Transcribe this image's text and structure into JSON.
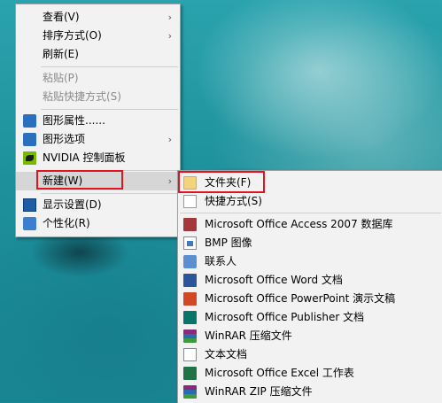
{
  "context_menu": {
    "items": [
      {
        "label": "查看(V)",
        "submenu": true
      },
      {
        "label": "排序方式(O)",
        "submenu": true
      },
      {
        "label": "刷新(E)"
      },
      {
        "label": "粘贴(P)",
        "disabled": true
      },
      {
        "label": "粘贴快捷方式(S)",
        "disabled": true
      },
      {
        "label": "图形属性......",
        "icon": "graphics-icon"
      },
      {
        "label": "图形选项",
        "icon": "graphics-options-icon",
        "submenu": true
      },
      {
        "label": "NVIDIA 控制面板",
        "icon": "nvidia-icon"
      },
      {
        "label": "新建(W)",
        "submenu": true,
        "highlighted": true
      },
      {
        "label": "显示设置(D)",
        "icon": "display-settings-icon"
      },
      {
        "label": "个性化(R)",
        "icon": "personalize-icon"
      }
    ],
    "submenu_arrow": "›"
  },
  "new_submenu": {
    "items": [
      {
        "label": "文件夹(F)",
        "icon": "folder-icon"
      },
      {
        "label": "快捷方式(S)",
        "icon": "shortcut-icon"
      },
      {
        "label": "Microsoft Office Access 2007 数据库",
        "icon": "access-icon"
      },
      {
        "label": "BMP 图像",
        "icon": "bmp-image-icon"
      },
      {
        "label": "联系人",
        "icon": "contact-icon"
      },
      {
        "label": "Microsoft Office Word 文档",
        "icon": "word-icon"
      },
      {
        "label": "Microsoft Office PowerPoint 演示文稿",
        "icon": "powerpoint-icon"
      },
      {
        "label": "Microsoft Office Publisher 文档",
        "icon": "publisher-icon"
      },
      {
        "label": "WinRAR 压缩文件",
        "icon": "winrar-icon"
      },
      {
        "label": "文本文档",
        "icon": "text-document-icon"
      },
      {
        "label": "Microsoft Office Excel 工作表",
        "icon": "excel-icon"
      },
      {
        "label": "WinRAR ZIP 压缩文件",
        "icon": "winrar-zip-icon"
      }
    ]
  },
  "colors": {
    "highlight_box": "#e0151f",
    "menu_bg": "#f2f2f2",
    "desktop": "#1b8a96"
  }
}
